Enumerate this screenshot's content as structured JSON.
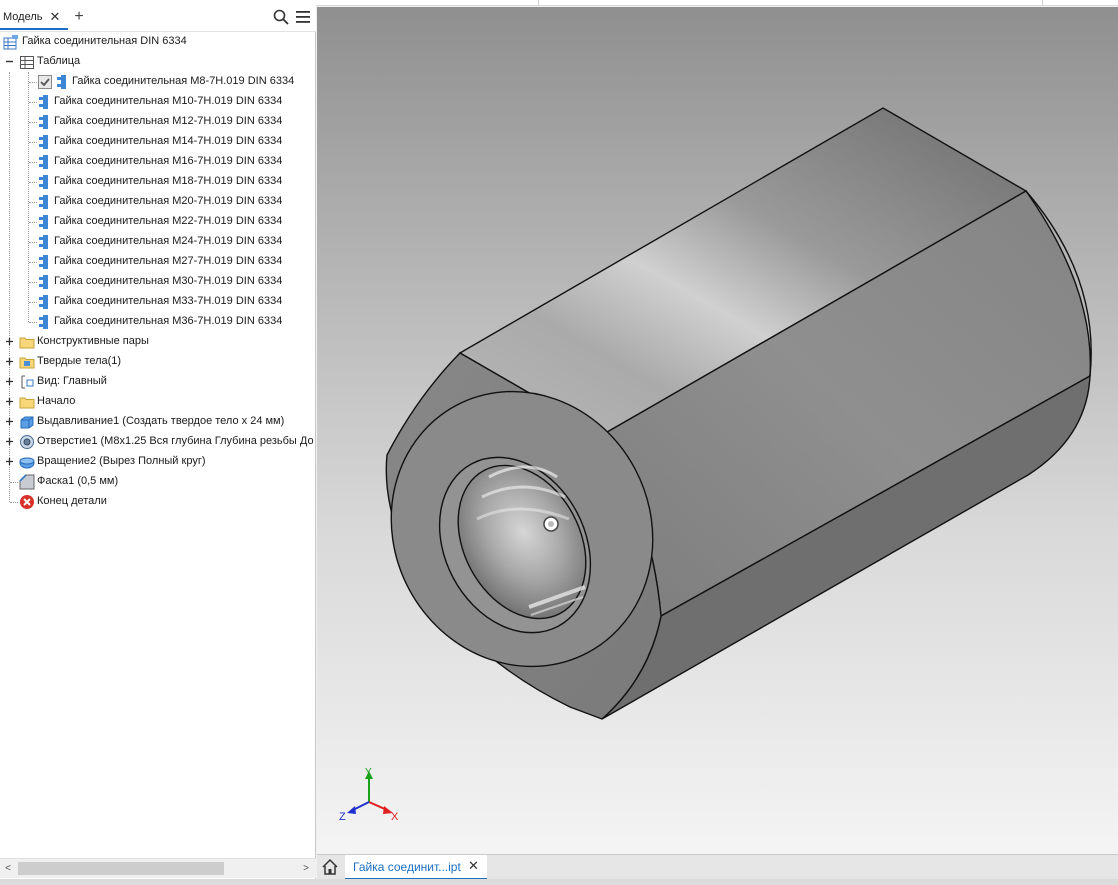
{
  "panel": {
    "tab_label": "Модель",
    "close_glyph": "✕",
    "add_glyph": "+",
    "search_icon": "search-icon",
    "menu_icon": "hamburger-menu-icon"
  },
  "tree": {
    "root": {
      "label": "Гайка соединительная DIN 6334",
      "icon": "part-table-icon"
    },
    "table": {
      "label": "Таблица",
      "icon": "table-icon",
      "expanded": true
    },
    "table_rows": [
      {
        "label": "Гайка соединительная M8-7H.019 DIN 6334",
        "checked": true
      },
      {
        "label": "Гайка соединительная M10-7H.019 DIN 6334"
      },
      {
        "label": "Гайка соединительная M12-7H.019 DIN 6334"
      },
      {
        "label": "Гайка соединительная M14-7H.019 DIN 6334"
      },
      {
        "label": "Гайка соединительная M16-7H.019 DIN 6334"
      },
      {
        "label": "Гайка соединительная M18-7H.019 DIN 6334"
      },
      {
        "label": "Гайка соединительная M20-7H.019 DIN 6334"
      },
      {
        "label": "Гайка соединительная M22-7H.019 DIN 6334"
      },
      {
        "label": "Гайка соединительная M24-7H.019 DIN 6334"
      },
      {
        "label": "Гайка соединительная M27-7H.019 DIN 6334"
      },
      {
        "label": "Гайка соединительная M30-7H.019 DIN 6334"
      },
      {
        "label": "Гайка соединительная M33-7H.019 DIN 6334"
      },
      {
        "label": "Гайка соединительная M36-7H.019 DIN 6334"
      }
    ],
    "features": [
      {
        "label": "Конструктивные пары",
        "icon": "folder-icon",
        "expandable": true
      },
      {
        "label": "Твердые тела(1)",
        "icon": "solid-bodies-folder-icon",
        "expandable": true
      },
      {
        "label": "Вид: Главный",
        "icon": "view-rep-icon",
        "expandable": true
      },
      {
        "label": "Начало",
        "icon": "folder-icon",
        "expandable": true
      },
      {
        "label": "Выдавливание1 (Создать твердое тело x 24 мм)",
        "icon": "extrude-icon",
        "expandable": true
      },
      {
        "label": "Отверстие1 (M8x1.25 Вся глубина Глубина резьбы До",
        "icon": "hole-icon",
        "expandable": true
      },
      {
        "label": "Вращение2 (Вырез Полный круг)",
        "icon": "revolve-icon",
        "expandable": true
      },
      {
        "label": "Фаска1 (0,5 мм)",
        "icon": "chamfer-icon",
        "expandable": false
      },
      {
        "label": "Конец детали",
        "icon": "end-of-part-icon",
        "expandable": false
      }
    ]
  },
  "viewport": {
    "axes": {
      "x": "X",
      "y": "Y",
      "z": "Z"
    },
    "colors": {
      "x": "#e02020",
      "y": "#1aa01a",
      "z": "#2030d0"
    }
  },
  "doc_tab": {
    "label": "Гайка соединит...ipt",
    "close_glyph": "✕"
  },
  "scroll": {
    "left_arrow": "<",
    "right_arrow": ">"
  },
  "accent": "#1b6fc2"
}
